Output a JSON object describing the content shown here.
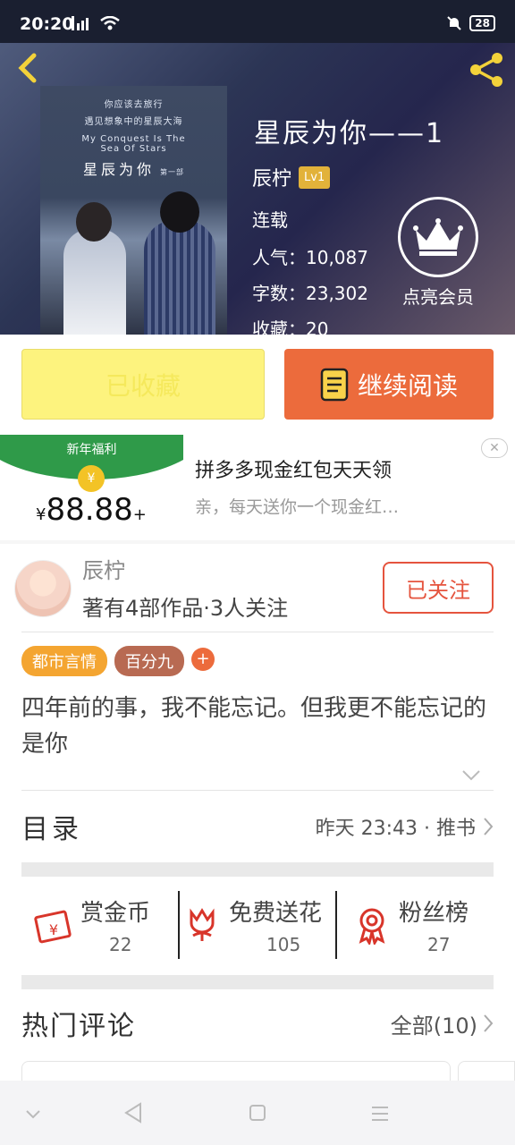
{
  "status_bar": {
    "time": "20:20",
    "battery": "28"
  },
  "book": {
    "cover_lines": [
      "你应该去旅行",
      "遇见想象中的星辰大海",
      "My Conquest Is The",
      "Sea Of Stars"
    ],
    "cover_title": "星辰为你",
    "cover_subtitle": "第一部",
    "title": "星辰为你——1",
    "author": "辰柠",
    "level": "Lv1",
    "status": "连载",
    "popularity": "人气：10,087",
    "word_count": "字数：23,302",
    "favorites": "收藏：20",
    "vip_label": "点亮会员"
  },
  "actions": {
    "collected_label": "已收藏",
    "read_label": "继续阅读"
  },
  "ad": {
    "image_caption": "新年福利",
    "amount": "88.88",
    "currency": "¥",
    "title": "拼多多现金红包天天领",
    "description": "亲，每天送你一个现金红…",
    "close": "✕"
  },
  "author_card": {
    "name": "辰柠",
    "stats": "著有4部作品·3人关注",
    "follow_label": "已关注",
    "tags": [
      {
        "label": "都市言情",
        "color": "#f4a531"
      },
      {
        "label": "百分九",
        "color": "#b86a52"
      },
      {
        "label": "+",
        "color": "#ec6b3c"
      }
    ],
    "summary": "四年前的事，我不能忘记。但我更不能忘记的是你"
  },
  "toc": {
    "label": "目录",
    "update": "昨天 23:43 · 推书"
  },
  "stats": [
    {
      "label": "赏金币",
      "value": "22",
      "icon": "red-envelope-icon"
    },
    {
      "label": "免费送花",
      "value": "105",
      "icon": "flower-icon"
    },
    {
      "label": "粉丝榜",
      "value": "27",
      "icon": "medal-icon"
    }
  ],
  "comments": {
    "label": "热门评论",
    "all_label": "全部(10)"
  },
  "colors": {
    "accent": "#ec6b3c",
    "collected_bg": "#fdf37e",
    "follow_red": "#e5543e"
  }
}
